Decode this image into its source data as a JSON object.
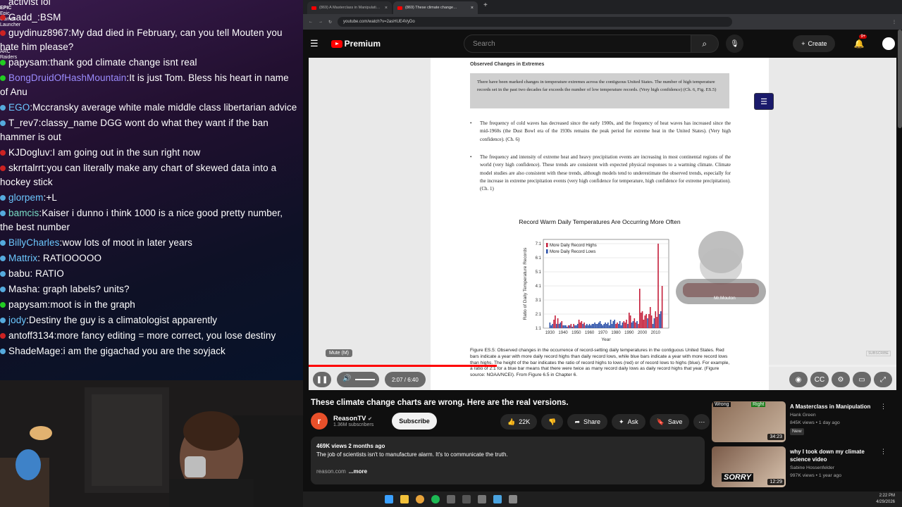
{
  "chat": {
    "top_partial": "activist lol",
    "messages": [
      {
        "user": "Gadd_",
        "text": "BSM",
        "color": "#ffffff",
        "badge": "#c22"
      },
      {
        "user": "guydinuz8967",
        "text": "My dad died in February, can you tell Mouten you hate him please?",
        "color": "#ffffff",
        "badge": "#c22"
      },
      {
        "user": "papysam",
        "text": "thank god climate change isnt real",
        "color": "#ffffff",
        "badge": "#2c2"
      },
      {
        "user": "BongDruidOfHashMountain",
        "text": "It is just Tom. Bless his heart in name of Anu",
        "color": "#9c8cff",
        "badge": "#2c2"
      },
      {
        "user": "EGO",
        "text": "Mccransky average white male middle class libertarian advice",
        "color": "#6cc8ff",
        "badge": "#5ad"
      },
      {
        "user": "T_rev7",
        "text": "classy_name DGG wont do what they want if the ban hammer is out",
        "color": "#ffffff",
        "badge": "#5ad"
      },
      {
        "user": "KJDogluv",
        "text": "I am going out in the sun right now",
        "color": "#ffffff",
        "badge": "#c22"
      },
      {
        "user": "skrrtalrrt",
        "text": "you can literally make any chart of skewed data into a hockey stick",
        "color": "#ffffff",
        "badge": "#c22"
      },
      {
        "user": "glorpem",
        "text": "+L",
        "color": "#6cc8ff",
        "badge": "#5ad"
      },
      {
        "user": "bamcis",
        "text": "Kaiser i dunno i think 1000 is a nice good pretty number, the best number",
        "color": "#7be0c8",
        "badge": "#5ad"
      },
      {
        "user": "BillyCharles",
        "text": "wow lots of moot in later years",
        "color": "#6cc8ff",
        "badge": "#5ad"
      },
      {
        "user": "Mattrix",
        "text": " RATIOOOOO",
        "color": "#6cc8ff",
        "badge": "#5ad"
      },
      {
        "user": "babu",
        "text": " RATIO",
        "color": "#ffffff",
        "badge": "#5ad"
      },
      {
        "user": "Masha",
        "text": " graph labels? units?",
        "color": "#ffffff",
        "badge": "#5ad"
      },
      {
        "user": "papysam",
        "text": "moot is in the graph",
        "color": "#ffffff",
        "badge": "#2c2"
      },
      {
        "user": "jody",
        "text": "Destiny the guy is a climatologist apparently",
        "color": "#6cc8ff",
        "badge": "#5ad"
      },
      {
        "user": "antoff3134",
        "text": "more fancy editing = more correct, you lose destiny",
        "color": "#ffffff",
        "badge": "#c22"
      },
      {
        "user": "ShadeMage",
        "text": "i am the gigachad you are the soyjack",
        "color": "#ffffff",
        "badge": "#5ad"
      }
    ]
  },
  "desktop": {
    "l1": "EPIC",
    "l2": "Epic Games",
    "l3": "Launcher",
    "l4": "ARC Raiders"
  },
  "browser": {
    "tab1": "(869) A Masterclass in Manipulati…",
    "tab2": "(869) These climate change…",
    "url": "youtube.com/watch?v=2asHUE4VyDo"
  },
  "yt": {
    "premium": "Premium",
    "search_placeholder": "Search",
    "create": "Create",
    "notif": "9+"
  },
  "doc": {
    "section": "Observed Changes in Extremes",
    "box": "There have been marked changes in temperature extremes across the contiguous United States. The number of high temperature records set in the past two decades far exceeds the number of low temperature records. (Very high confidence) (Ch. 6, Fig. ES.5)",
    "b1": "The frequency of cold waves has decreased since the early 1900s, and the frequency of heat waves has increased since the mid-1960s (the Dust Bowl era of the 1930s remains the peak period for extreme heat in the United States). (Very high confidence). (Ch. 6)",
    "b2": "The frequency and intensity of extreme heat and heavy precipitation events are increasing in most continental regions of the world (very high confidence). These trends are consistent with expected physical responses to a warming climate. Climate model studies are also consistent with these trends, although models tend to underestimate the observed trends, especially for the increase in extreme precipitation events (very high confidence for temperature, high confidence for extreme precipitation). (Ch. 1)",
    "caption": "Figure ES.5: Observed changes in the occurrence of record-setting daily temperatures in the contiguous United States. Red bars indicate a year with more daily record highs than daily record lows, while blue bars indicate a year with more record lows than highs. The height of the bar indicates the ratio of record highs to lows (red) or of record lows to highs (blue). For example, a ratio of 2:1 for a blue bar means that there were twice as many record daily lows as daily record highs that year. (Figure source: NOAA/NCEI). From Figure 6.5 in Chapter 6.",
    "mascot_label": "Mr.Mouton",
    "subscribe_mark": "SUBSCRIBE"
  },
  "chart_data": {
    "type": "bar",
    "title": "Record Warm Daily Temperatures Are Occurring More Often",
    "xlabel": "Year",
    "ylabel": "Ratio of Daily Temperature Records",
    "yticks": [
      "1:1",
      "2:1",
      "3:1",
      "4:1",
      "5:1",
      "6:1",
      "7:1"
    ],
    "xticks": [
      "1930",
      "1940",
      "1950",
      "1960",
      "1970",
      "1980",
      "1990",
      "2000",
      "2010"
    ],
    "legend": [
      "More Daily Record Highs",
      "More Daily Record Lows"
    ],
    "colors": {
      "highs": "#c41e3a",
      "lows": "#2a4fa8"
    },
    "x": [
      1930,
      1931,
      1932,
      1933,
      1934,
      1935,
      1936,
      1937,
      1938,
      1939,
      1940,
      1941,
      1942,
      1943,
      1944,
      1945,
      1946,
      1947,
      1948,
      1949,
      1950,
      1951,
      1952,
      1953,
      1954,
      1955,
      1956,
      1957,
      1958,
      1959,
      1960,
      1961,
      1962,
      1963,
      1964,
      1965,
      1966,
      1967,
      1968,
      1969,
      1970,
      1971,
      1972,
      1973,
      1974,
      1975,
      1976,
      1977,
      1978,
      1979,
      1980,
      1981,
      1982,
      1983,
      1984,
      1985,
      1986,
      1987,
      1988,
      1989,
      1990,
      1991,
      1992,
      1993,
      1994,
      1995,
      1996,
      1997,
      1998,
      1999,
      2000,
      2001,
      2002,
      2003,
      2004,
      2005,
      2006,
      2007,
      2008,
      2009,
      2010,
      2011,
      2012,
      2013,
      2014,
      2015
    ],
    "y": [
      1.4,
      1.2,
      1.3,
      1.6,
      1.9,
      1.3,
      1.7,
      1.3,
      1.4,
      1.5,
      1.2,
      1.2,
      1.2,
      1.1,
      1.2,
      1.2,
      1.3,
      1.1,
      1.3,
      1.2,
      1.2,
      1.3,
      1.6,
      1.4,
      1.5,
      1.3,
      1.4,
      1.2,
      1.3,
      1.2,
      1.3,
      1.2,
      1.3,
      1.3,
      1.4,
      1.3,
      1.3,
      1.4,
      1.5,
      1.3,
      1.2,
      1.3,
      1.4,
      1.3,
      1.4,
      1.2,
      1.6,
      1.3,
      1.5,
      1.6,
      1.3,
      1.4,
      1.3,
      1.5,
      1.2,
      1.4,
      1.5,
      1.4,
      1.6,
      1.3,
      2.1,
      1.9,
      1.4,
      1.5,
      1.7,
      1.4,
      1.5,
      1.3,
      3.8,
      2.1,
      2.2,
      1.6,
      1.9,
      2.0,
      1.7,
      2.0,
      2.5,
      1.9,
      1.3,
      1.7,
      2.2,
      1.8,
      7.0,
      2.0,
      2.2,
      4.0
    ],
    "sign": [
      "lows",
      "lows",
      "lows",
      "highs",
      "highs",
      "lows",
      "highs",
      "lows",
      "lows",
      "highs",
      "lows",
      "lows",
      "lows",
      "lows",
      "highs",
      "lows",
      "highs",
      "lows",
      "highs",
      "lows",
      "lows",
      "lows",
      "highs",
      "highs",
      "highs",
      "lows",
      "highs",
      "lows",
      "lows",
      "lows",
      "lows",
      "lows",
      "lows",
      "lows",
      "lows",
      "lows",
      "lows",
      "lows",
      "lows",
      "lows",
      "lows",
      "lows",
      "lows",
      "lows",
      "lows",
      "lows",
      "lows",
      "lows",
      "lows",
      "lows",
      "highs",
      "highs",
      "lows",
      "lows",
      "lows",
      "lows",
      "highs",
      "highs",
      "highs",
      "lows",
      "highs",
      "highs",
      "lows",
      "lows",
      "highs",
      "highs",
      "lows",
      "highs",
      "highs",
      "highs",
      "highs",
      "highs",
      "highs",
      "highs",
      "lows",
      "highs",
      "highs",
      "highs",
      "lows",
      "lows",
      "highs",
      "highs",
      "highs",
      "lows",
      "lows",
      "highs"
    ],
    "ylim": [
      1,
      7.3
    ]
  },
  "player": {
    "mute_tip": "Mute (M)",
    "time": "2:07 / 6:40",
    "progress": 0.32
  },
  "video": {
    "title": "These climate change charts are wrong. Here are the real versions.",
    "channel": "ReasonTV",
    "subs": "1.36M subscribers",
    "subscribe": "Subscribe",
    "likes": "22K",
    "share": "Share",
    "ask": "Ask",
    "save": "Save",
    "meta": "469K views  2 months ago",
    "desc": "The job of scientists isn't to manufacture alarm. It's to communicate the truth.",
    "link": "reason.com",
    "more": "...more"
  },
  "recs": [
    {
      "title": "A Masterclass in Manipulation",
      "channel": "Hank Green",
      "meta": "845K views • 1 day ago",
      "badge": "New",
      "dur": "34:23",
      "thumb_l": "Wrong",
      "thumb_r": "Right"
    },
    {
      "title": "why I took down my climate science video",
      "channel": "Sabine Hossenfelder",
      "meta": "997K views • 1 year ago",
      "dur": "12:29",
      "thumb": "SORRY"
    }
  ],
  "clock": {
    "time": "2:22 PM",
    "date": "4/29/2026"
  }
}
